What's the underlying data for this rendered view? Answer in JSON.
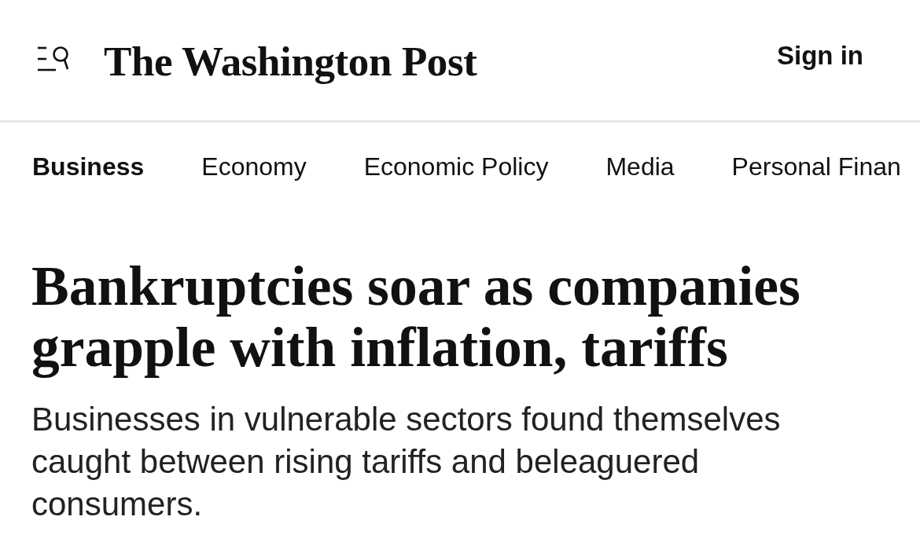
{
  "header": {
    "logo": "The Washington Post",
    "sign_in": "Sign in"
  },
  "nav": {
    "items": [
      {
        "label": "Business",
        "selected": true
      },
      {
        "label": "Economy",
        "selected": false
      },
      {
        "label": "Economic Policy",
        "selected": false
      },
      {
        "label": "Media",
        "selected": false
      },
      {
        "label": "Personal Finan",
        "selected": false
      }
    ]
  },
  "article": {
    "headline": "Bankruptcies soar as companies grapple with inflation, tariffs",
    "subheadline": "Businesses in vulnerable sectors found themselves caught between rising tariffs and beleaguered consumers."
  }
}
